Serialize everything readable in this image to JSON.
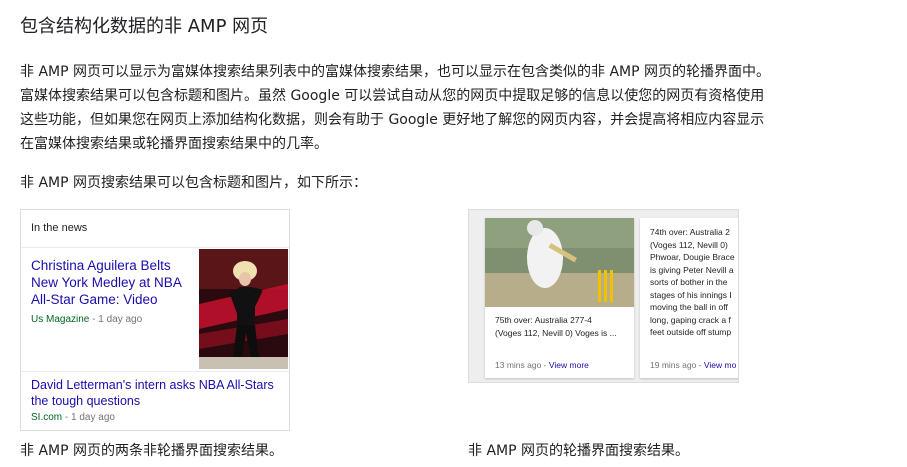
{
  "heading": "包含结构化数据的非 AMP 网页",
  "paragraph": [
    "非 AMP 网页可以显示为富媒体搜索结果列表中的富媒体搜索结果，也可以显示在包含类似的非 AMP 网页的轮播界面中。",
    "富媒体搜索结果可以包含标题和图片。虽然 Google 可以尝试自动从您的网页中提取足够的信息以使您的网页有资格使用",
    "这些功能，但如果您在网页上添加结构化数据，则会有助于 Google 更好地了解您的网页内容，并会提高将相应内容显示",
    "在富媒体搜索结果或轮播界面搜索结果中的几率。"
  ],
  "subtitle": "非 AMP 网页搜索结果可以包含标题和图片，如下所示：",
  "news_example": {
    "header": "In the news",
    "items": [
      {
        "title": "Christina Aguilera Belts New York Medley at NBA All-Star Game: Video",
        "source": "Us Magazine",
        "time": " - 1 day ago"
      },
      {
        "title": "David Letterman's intern asks NBA All-Stars the tough questions",
        "source": "SI.com",
        "time": " - 1 day ago"
      }
    ],
    "caption": "非 AMP 网页的两条非轮播界面搜索结果。"
  },
  "carousel_example": {
    "cards": [
      {
        "text_lines": [
          "75th over: Australia 277-4",
          "(Voges 112, Nevill 0) Voges is ..."
        ],
        "time": "13 mins ago - ",
        "link": "View more"
      },
      {
        "text_lines": [
          "74th over: Australia 2",
          "(Voges 112, Nevill 0)",
          "Phwoar, Dougie Brace",
          "is giving Peter Nevill a",
          "sorts of bother in the",
          "stages of his innings I",
          "moving the ball in off",
          "long, gaping crack a f",
          "feet outside off stump"
        ],
        "time": "19 mins ago - ",
        "link": "View mo"
      }
    ],
    "caption": "非 AMP 网页的轮播界面搜索结果。"
  }
}
